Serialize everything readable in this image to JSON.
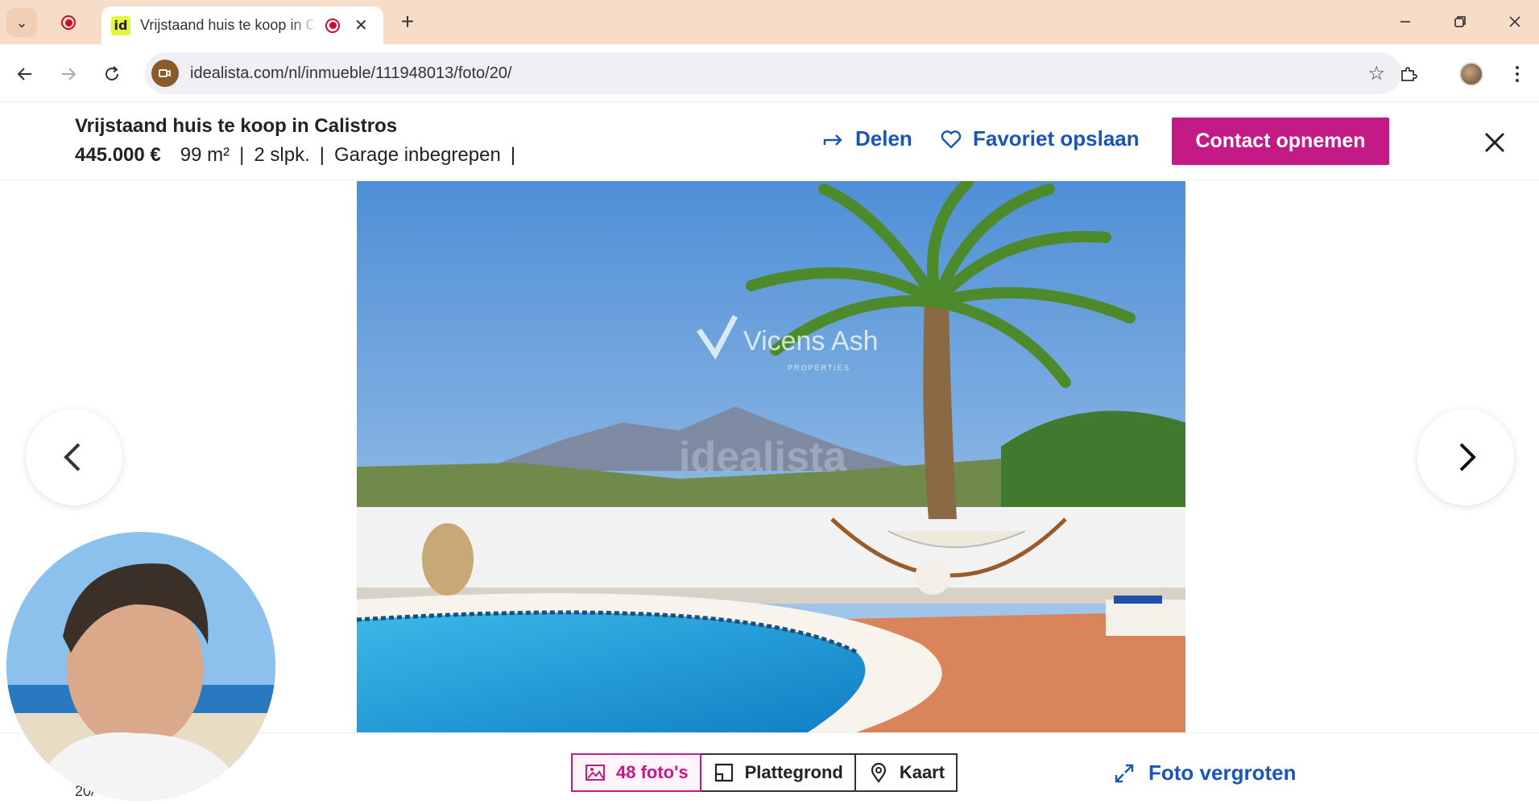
{
  "browser": {
    "tab_title": "Vrijstaand huis te koop in C",
    "favicon_text": "id",
    "url": "idealista.com/nl/inmueble/111948013/foto/20/"
  },
  "listing": {
    "title": "Vrijstaand huis te koop in Calistros",
    "price": "445.000 €",
    "area": "99 m²",
    "bedrooms": "2 slpk.",
    "garage": "Garage inbegrepen",
    "separator": "|"
  },
  "actions": {
    "share_label": "Delen",
    "favorite_label": "Favoriet opslaan",
    "contact_label": "Contact opnemen"
  },
  "photo": {
    "watermark_brand": "Vicens Ash",
    "watermark_sub": "PROPERTIES",
    "watermark_site": "idealista"
  },
  "bottom": {
    "photos_label": "48 foto's",
    "floorplan_label": "Plattegrond",
    "map_label": "Kaart",
    "enlarge_label": "Foto vergroten",
    "counter": "20/"
  },
  "colors": {
    "accent": "#c41a86",
    "link": "#1a56b8",
    "tabstrip": "#f7dcc7"
  }
}
